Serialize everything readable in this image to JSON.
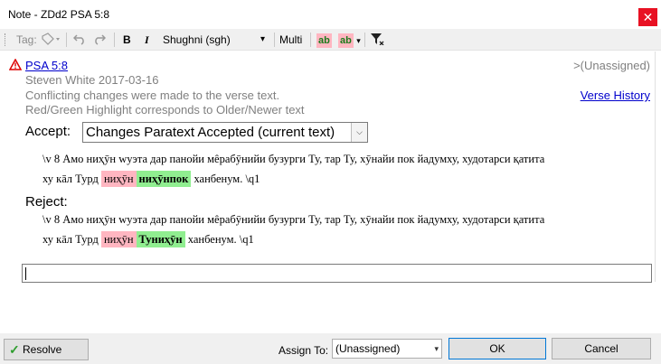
{
  "window": {
    "title": "Note - ZDd2 PSA 5:8",
    "close_glyph": "✕"
  },
  "toolbar": {
    "tag_label": "Tag:",
    "language": "Shughni (sgh)",
    "multi_label": "Multi",
    "bold_label": "B",
    "italic_label": "I",
    "highlight_label": "ab",
    "highlight2_label": "ab",
    "language_arrow": "▾"
  },
  "note": {
    "reference": "PSA 5:8",
    "assigned": ">(Unassigned)",
    "author": "Steven White  2017-03-16",
    "message1": "Conflicting changes were made to the verse text.",
    "message2": "Red/Green Highlight corresponds to Older/Newer text",
    "verse_history": "Verse History"
  },
  "accept": {
    "label": "Accept:",
    "selected": "Changes Paratext Accepted (current text)",
    "verse_prefix": "\\v 8 Амо ниҳӯн wуэта дар панойи мêрабӯнийи бузурги Ту, тар Ту, хӯнайи пок йадумху, худотарси қатита",
    "line2_start": "ху кāл Турд ",
    "old": "ниҳӯн",
    "new": "ниҳӯнпок",
    "line2_end": " ханбенум. \\q1"
  },
  "reject": {
    "label": "Reject:",
    "verse_prefix": "\\v 8 Амо ниҳӯн wуэта дар панойи мêрабӯнийи бузурги Ту, тар Ту, хӯнайи пок йадумху, худотарси қатита",
    "line2_start": "ху кāл Турд ",
    "old": "ниҳӯн",
    "new": "Туниҳӯн",
    "line2_end": " ханбенум. \\q1"
  },
  "comment": {
    "value": ""
  },
  "footer": {
    "resolve_label": "Resolve",
    "assign_label": "Assign To:",
    "assign_value": "(Unassigned)",
    "ok_label": "OK",
    "cancel_label": "Cancel"
  },
  "colors": {
    "old_highlight": "#ffb6c1",
    "new_highlight": "#90ee90",
    "link": "#0000cc",
    "close": "#e81123"
  }
}
